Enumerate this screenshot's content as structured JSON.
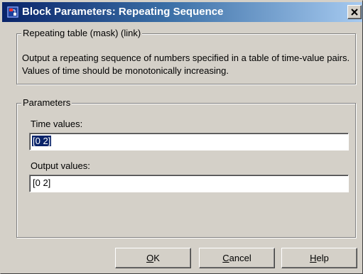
{
  "window": {
    "title": "Block Parameters: Repeating Sequence",
    "close_glyph": "×",
    "icon": "simulink-block-icon"
  },
  "mask_group": {
    "legend": "Repeating table (mask) (link)",
    "description": "Output a repeating sequence of numbers specified in a table of time-value pairs. Values of time should be monotonically increasing."
  },
  "parameters_group": {
    "legend": "Parameters",
    "time_values": {
      "label": "Time values:",
      "value": "[0 2]",
      "selected": true
    },
    "output_values": {
      "label": "Output values:",
      "value": "[0 2]"
    }
  },
  "buttons": {
    "ok": {
      "mnemonic": "O",
      "rest": "K"
    },
    "cancel": {
      "mnemonic": "C",
      "rest": "ancel"
    },
    "help": {
      "mnemonic": "H",
      "rest": "elp"
    }
  },
  "colors": {
    "titlebar_start": "#0a246a",
    "titlebar_end": "#a6caf0",
    "dialog_face": "#d4d0c8",
    "selection": "#0a246a"
  }
}
